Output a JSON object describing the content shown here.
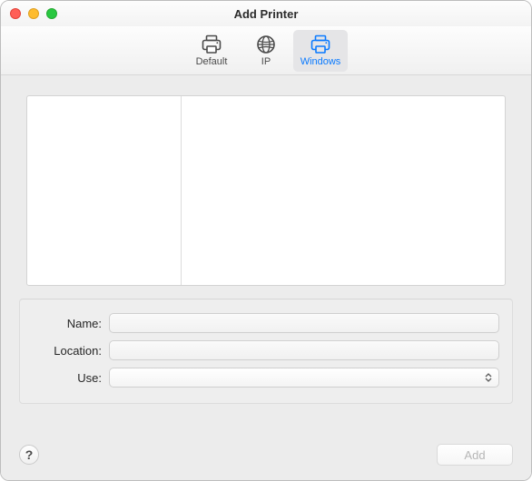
{
  "window": {
    "title": "Add Printer"
  },
  "tabs": {
    "default": {
      "label": "Default"
    },
    "ip": {
      "label": "IP"
    },
    "windows": {
      "label": "Windows",
      "selected": true
    }
  },
  "form": {
    "name": {
      "label": "Name:",
      "value": ""
    },
    "location": {
      "label": "Location:",
      "value": ""
    },
    "use": {
      "label": "Use:",
      "value": ""
    }
  },
  "footer": {
    "help_label": "?",
    "add_label": "Add",
    "add_enabled": false
  }
}
